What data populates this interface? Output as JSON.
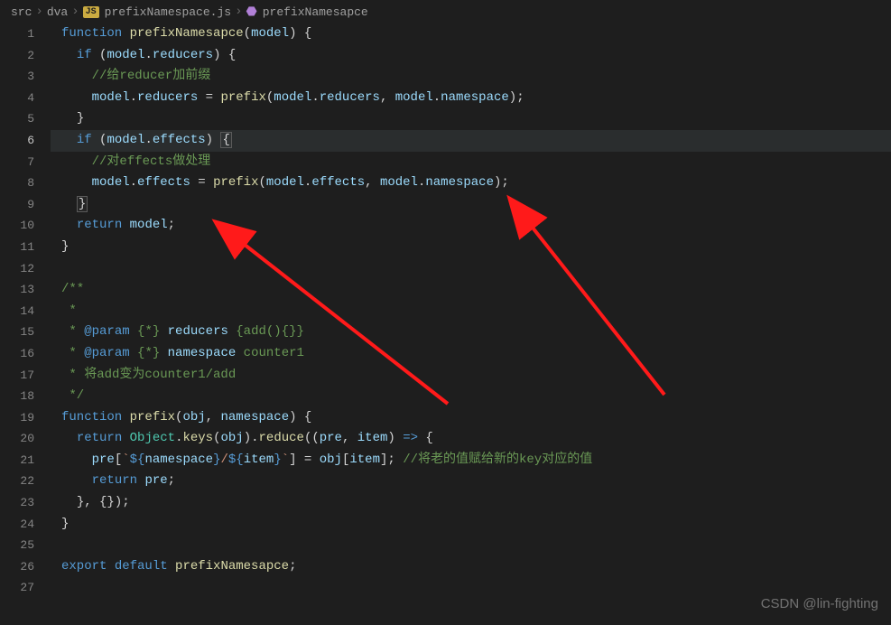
{
  "breadcrumb": {
    "seg1": "src",
    "seg2": "dva",
    "seg3_badge": "JS",
    "seg3": "prefixNamespace.js",
    "seg4": "prefixNamesapce"
  },
  "gutter": {
    "lines": [
      "1",
      "2",
      "3",
      "4",
      "5",
      "6",
      "7",
      "8",
      "9",
      "10",
      "11",
      "12",
      "13",
      "14",
      "15",
      "16",
      "17",
      "18",
      "19",
      "20",
      "21",
      "22",
      "23",
      "24",
      "25",
      "26",
      "27"
    ],
    "current": 6
  },
  "code": {
    "l1": {
      "kw1": "function",
      "fn": "prefixNamesapce",
      "p1": "(",
      "v1": "model",
      "p2": ") {"
    },
    "l2": {
      "kw": "if",
      "p1": " (",
      "v1": "model",
      "p2": ".",
      "v2": "reducers",
      "p3": ") {"
    },
    "l3": {
      "c": "//给reducer加前缀"
    },
    "l4": {
      "v1": "model",
      "d1": ".",
      "v2": "reducers",
      "eq": " = ",
      "fn": "prefix",
      "p1": "(",
      "v3": "model",
      "d2": ".",
      "v4": "reducers",
      "c1": ", ",
      "v5": "model",
      "d3": ".",
      "v6": "namespace",
      "p2": ");"
    },
    "l5": {
      "p": "}"
    },
    "l6": {
      "kw": "if",
      "p1": " (",
      "v1": "model",
      "p2": ".",
      "v2": "effects",
      "p3": ") ",
      "brace": "{"
    },
    "l7": {
      "c": "//对effects做处理"
    },
    "l8": {
      "v1": "model",
      "d1": ".",
      "v2": "effects",
      "eq": " = ",
      "fn": "prefix",
      "p1": "(",
      "v3": "model",
      "d2": ".",
      "v4": "effects",
      "c1": ", ",
      "v5": "model",
      "d3": ".",
      "v6": "namespace",
      "p2": ");"
    },
    "l9": {
      "brace": "}"
    },
    "l10": {
      "kw": "return",
      "sp": " ",
      "v": "model",
      "p": ";"
    },
    "l11": {
      "p": "}"
    },
    "l13": {
      "c": "/**"
    },
    "l14": {
      "c": " *"
    },
    "l15": {
      "star": " * ",
      "tag": "@param",
      "rest": " {*} ",
      "name": "reducers",
      "tail": " {add(){}}"
    },
    "l16": {
      "star": " * ",
      "tag": "@param",
      "rest": " {*} ",
      "name": "namespace",
      "tail": " counter1"
    },
    "l17": {
      "c": " * 将add变为counter1/add"
    },
    "l18": {
      "c": " */"
    },
    "l19": {
      "kw1": "function",
      "fn": "prefix",
      "p1": "(",
      "v1": "obj",
      "c1": ", ",
      "v2": "namespace",
      "p2": ") {"
    },
    "l20": {
      "kw": "return",
      "sp": " ",
      "cls": "Object",
      "d1": ".",
      "fn1": "keys",
      "p1": "(",
      "v1": "obj",
      "p2": ").",
      "fn2": "reduce",
      "p3": "((",
      "v2": "pre",
      "c1": ", ",
      "v3": "item",
      "p4": ") ",
      "arrow": "=>",
      "p5": " {"
    },
    "l21": {
      "v1": "pre",
      "p1": "[",
      "bt1": "`",
      "s1": "${",
      "v2": "namespace",
      "s2": "}",
      "slash": "/",
      "s3": "${",
      "v3": "item",
      "s4": "}",
      "bt2": "`",
      "p2": "] = ",
      "v4": "obj",
      "p3": "[",
      "v5": "item",
      "p4": "]; ",
      "cmt": "//将老的值赋给新的key对应的值"
    },
    "l22": {
      "kw": "return",
      "sp": " ",
      "v": "pre",
      "p": ";"
    },
    "l23": {
      "p": "}, {});"
    },
    "l24": {
      "p": "}"
    },
    "l26": {
      "kw1": "export",
      "sp1": " ",
      "kw2": "default",
      "sp2": " ",
      "fn": "prefixNamesapce",
      "p": ";"
    }
  },
  "watermark": "CSDN @lin-fighting"
}
